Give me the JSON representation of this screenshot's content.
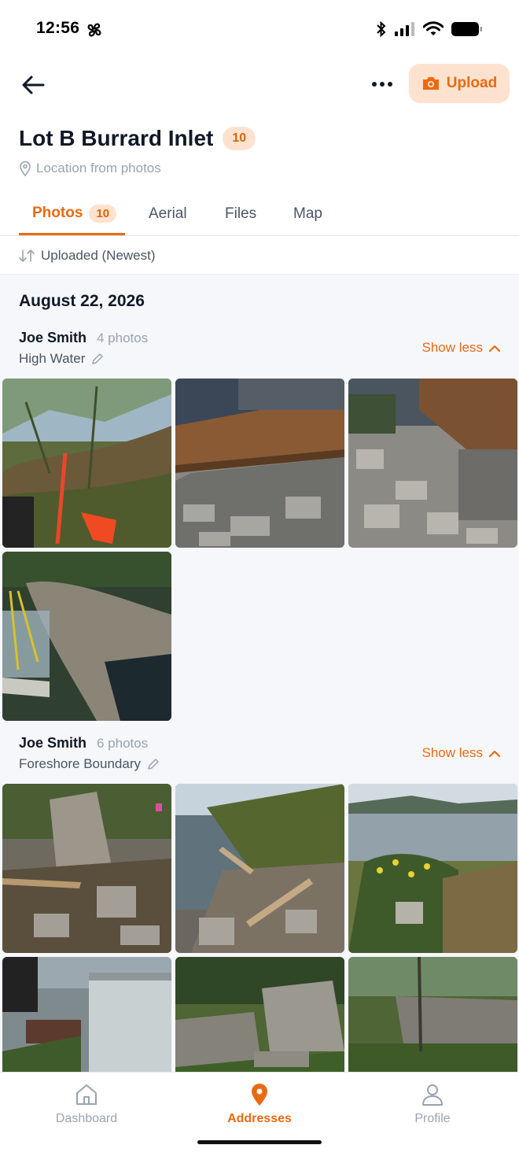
{
  "status_bar": {
    "time": "12:56"
  },
  "header": {
    "upload_label": "Upload",
    "title": "Lot B Burrard Inlet",
    "count": "10",
    "location": "Location from photos"
  },
  "tabs": [
    {
      "label": "Photos",
      "count": "10"
    },
    {
      "label": "Aerial"
    },
    {
      "label": "Files"
    },
    {
      "label": "Map"
    }
  ],
  "sort": {
    "label": "Uploaded (Newest)"
  },
  "content": {
    "date": "August 22, 2026",
    "groups": [
      {
        "uploader": "Joe Smith",
        "photo_count": "4 photos",
        "label": "High Water",
        "toggle": "Show less"
      },
      {
        "uploader": "Joe Smith",
        "photo_count": "6 photos",
        "label": "Foreshore Boundary",
        "toggle": "Show less"
      }
    ]
  },
  "bottom_nav": [
    {
      "label": "Dashboard",
      "icon": "home-icon"
    },
    {
      "label": "Addresses",
      "icon": "map-pin-icon",
      "active": true
    },
    {
      "label": "Profile",
      "icon": "user-icon"
    }
  ],
  "colors": {
    "accent": "#ea6a12",
    "accent_soft": "#fde3cf"
  }
}
